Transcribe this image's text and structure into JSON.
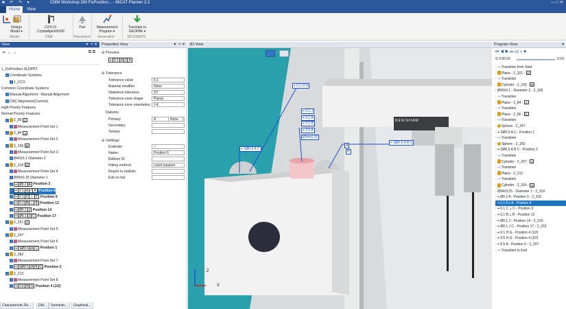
{
  "window": {
    "title": "CMM Workshop DM FixPosition... - MiCAT Planner 2.2",
    "controls": "—  □  ✕"
  },
  "menu": {
    "home": "Home",
    "view": "View"
  },
  "ribbon": {
    "buttons": [
      {
        "label": "Coord. Systems",
        "icon": "coordinate-icon"
      },
      {
        "label": "Design Model ▾",
        "icon": "design-model-icon"
      },
      {
        "label": "CXTLO-CrystaApex09106",
        "icon": "cmm-icon"
      },
      {
        "label": "Part",
        "icon": "part-icon"
      },
      {
        "label": "Measurement Program ▾",
        "icon": "measurement-program-icon"
      },
      {
        "label": "Translate to GEOPAK ▾",
        "icon": "translate-icon"
      }
    ],
    "groups": [
      "Model",
      "DME",
      "Placement",
      "Generation",
      "MCOSMOS"
    ]
  },
  "left_panel": {
    "title": "View",
    "tree": [
      {
        "text": "1_FixPosition.SLDPRT",
        "indent": 0
      },
      {
        "text": "Coordinate Systems",
        "indent": 1
      },
      {
        "text": "1_CCS",
        "indent": 2
      },
      {
        "text": "Common Coordinate Systems",
        "indent": 0
      },
      {
        "text": "Manual Alignment : Manual Alignment",
        "indent": 1
      },
      {
        "text": "CNC Alignment(Current)",
        "indent": 1
      },
      {
        "text": "High Priority Features",
        "indent": 0
      },
      {
        "text": "Normal Priority Features",
        "indent": 0
      },
      {
        "text": "2_86",
        "badge": "C",
        "indent": 1
      },
      {
        "text": "Measurement Point Set 1",
        "indent": 2
      },
      {
        "text": "2_84",
        "badge": "A",
        "indent": 1
      },
      {
        "text": "Measurement Point Set 2",
        "indent": 2
      },
      {
        "text": "2_165",
        "badge": "B",
        "indent": 1
      },
      {
        "text": "Measurement Point Set 3",
        "indent": 2
      },
      {
        "text": "Ø40±0.1 Diameter 2",
        "indent": 2
      },
      {
        "text": "2_316",
        "badge": "D",
        "indent": 1
      },
      {
        "text": "Measurement Point Set 4",
        "indent": 2
      },
      {
        "text": "Ø34±0.25 Diameter 1",
        "indent": 2
      },
      {
        "fcf": [
          "⌖",
          "Ø0.2",
          "A"
        ],
        "text": "Position 3",
        "indent": 2
      },
      {
        "fcf": [
          "⌖",
          "0.1",
          "A",
          "⫽",
          "A"
        ],
        "text": "Position 6",
        "indent": 2,
        "selected": true
      },
      {
        "fcf": [
          "⌖",
          "0.1",
          "C",
          "⊥",
          "C"
        ],
        "text": "Position 9",
        "indent": 2
      },
      {
        "fcf": [
          "⌖",
          "0.1",
          "B",
          "⊥",
          "B"
        ],
        "text": "Position 12",
        "indent": 2
      },
      {
        "fcf": [
          "⌖",
          "Ø0.1",
          "J"
        ],
        "text": "Position 14",
        "indent": 2
      },
      {
        "fcf": [
          "⌖",
          "Ø0.1",
          "J",
          "C"
        ],
        "text": "Position 17",
        "indent": 2
      },
      {
        "text": "2_321",
        "badge": "H",
        "indent": 1
      },
      {
        "text": "Measurement Point Set 5",
        "indent": 2
      },
      {
        "text": "2_247",
        "indent": 1
      },
      {
        "text": "Measurement Point Set 6",
        "indent": 2
      },
      {
        "fcf": [
          "⌖",
          "SØ0.5",
          "A",
          "C"
        ],
        "text": "Position 1",
        "indent": 2
      },
      {
        "text": "2_282",
        "indent": 1
      },
      {
        "text": "Measurement Point Set 7",
        "indent": 2
      },
      {
        "fcf": [
          "⌖",
          "SØ0.5",
          "A",
          "B",
          "C"
        ],
        "text": "Position 2",
        "indent": 2
      },
      {
        "text": "2_212",
        "indent": 1
      },
      {
        "text": "Measurement Point Set 8",
        "indent": 2
      },
      {
        "fcf": [
          "⌖",
          "0.5",
          "H",
          "G"
        ],
        "text": "Position 4 (1/2)",
        "indent": 2
      }
    ],
    "tabs": [
      "Characteristic Re...",
      "DM...",
      "Semantic...",
      "Graphical..."
    ]
  },
  "properties": {
    "title": "Properties View",
    "preview_label": "Preview",
    "preview_fcf": [
      "⌖",
      "0.1",
      "A",
      "⫽",
      "A"
    ],
    "tolerance_label": "Tolerance",
    "rows": [
      {
        "label": "Tolerance value",
        "value": "0.1"
      },
      {
        "label": "Material modifier",
        "value": "None"
      },
      {
        "label": "Statistical tolerance",
        "value": "ST"
      },
      {
        "label": "Tolerance zone shape",
        "value": "Planar"
      },
      {
        "label": "Tolerance zone orientation",
        "value": "⫽ A"
      }
    ],
    "datums_label": "Datums",
    "datum_rows": [
      {
        "label": "Primary",
        "value": "A",
        "value2": "None"
      },
      {
        "label": "Secondary",
        "value": ""
      },
      {
        "label": "Tertiary",
        "value": ""
      }
    ],
    "settings_label": "Settings",
    "settings_rows": [
      {
        "label": "Evaluate",
        "value": "✓"
      },
      {
        "label": "Name",
        "value": "Position 6"
      },
      {
        "label": "Balloon ID",
        "value": ""
      },
      {
        "label": "Fitting method",
        "value": "Least squares"
      },
      {
        "label": "Report to statistic",
        "value": ""
      },
      {
        "label": "Exit on fail",
        "value": ""
      }
    ]
  },
  "view3d": {
    "title": "3D View",
    "toolbar_zoom": "0%",
    "annotations": [
      {
        "text": "⌖ 0.1 H G"
      },
      {
        "text": "⌖ 0.1 J"
      },
      {
        "text": "⌖ 0.1 A"
      },
      {
        "text": "⌖ 0.1 B"
      },
      {
        "text": "⌖ 0.5 A"
      },
      {
        "text": "⌖ SØ0.5 A C"
      },
      {
        "text": "⌖ SØ0.5 A B C"
      },
      {
        "text": "Ø34±0.25"
      }
    ],
    "probe_brand": "RENISHAW",
    "axis_z": "Z",
    "axis_x": "X",
    "datum_a_label": "A",
    "datum_h_label": "H"
  },
  "program": {
    "title": "Program View",
    "time": "0:00.00",
    "time_end": "0:14",
    "speed": "x1",
    "rows": [
      {
        "text": "Transition from Start"
      },
      {
        "text": "Plane - 2_321 -",
        "badge": "H"
      },
      {
        "text": "Transition"
      },
      {
        "text": "Cylinder - 2_165 -",
        "badge": "B"
      },
      {
        "text": "Ø40±0.1 - Diameter 2 - 2_165"
      },
      {
        "text": "Transition"
      },
      {
        "text": "Plane - 2_84 -",
        "badge": "A"
      },
      {
        "text": "Transition"
      },
      {
        "text": "Plane - 2_86 -",
        "badge": "C"
      },
      {
        "text": "Transition"
      },
      {
        "text": "Sphere - 2_247"
      },
      {
        "text": "⌖ SØ0.5 A C - Position 1"
      },
      {
        "text": "Transition"
      },
      {
        "text": "Sphere - 2_282"
      },
      {
        "text": "⌖ SØ0.5 A B C - Position 2"
      },
      {
        "text": "Transition"
      },
      {
        "text": "Cylinder - 2_207 -",
        "badge": "J"
      },
      {
        "text": "Transition"
      },
      {
        "text": "Plane - 2_212"
      },
      {
        "text": "Transition"
      },
      {
        "text": "Cylinder - 2_316 -",
        "badge": "D"
      },
      {
        "text": "Ø34±0.25 - Diameter 1 - 2_316"
      },
      {
        "text": "⌖ Ø0.2 A - Position 3 - 2_316"
      },
      {
        "text": "⌖ 0.1 A ⫽ A - Position 6",
        "selected": true
      },
      {
        "text": "⌖ 0.1 C ⊥ C - Position 9"
      },
      {
        "text": "⌖ 0.1 B ⊥ B - Position 12"
      },
      {
        "text": "⌖ Ø0.1 J - Position 14 - 2_316"
      },
      {
        "text": "⌖ Ø0.1 J C - Position 17 - 2_316"
      },
      {
        "text": "⌖ 0.1 H G - Position 4 (1/2)"
      },
      {
        "text": "⌖ 0.5 H G - Position 4 (2/2)"
      },
      {
        "text": "⌖ 0.5 A - Position 5 - 2_207"
      },
      {
        "text": "Transition to End"
      }
    ]
  },
  "colors": {
    "accent": "#2b579a",
    "selection": "#1e73be",
    "viewport": "#2ba0ad",
    "annotation": "#1a4fd6"
  }
}
